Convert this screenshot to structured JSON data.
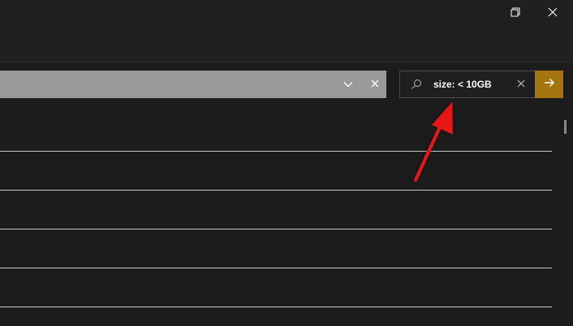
{
  "window": {
    "controls": {
      "restore_icon": "restore-icon",
      "close_icon": "close-icon"
    }
  },
  "address_bar": {
    "value": "",
    "dropdown_icon": "chevron-down-icon",
    "clear_icon": "close-icon"
  },
  "search": {
    "value": "size: < 10GB",
    "search_icon": "search-icon",
    "clear_icon": "close-icon"
  },
  "go_button": {
    "icon": "arrow-right-icon",
    "color": "#a5740f"
  },
  "annotation": {
    "type": "red-arrow",
    "color": "#e81414",
    "points_to": "search-input"
  },
  "list": {
    "row_count": 5
  }
}
